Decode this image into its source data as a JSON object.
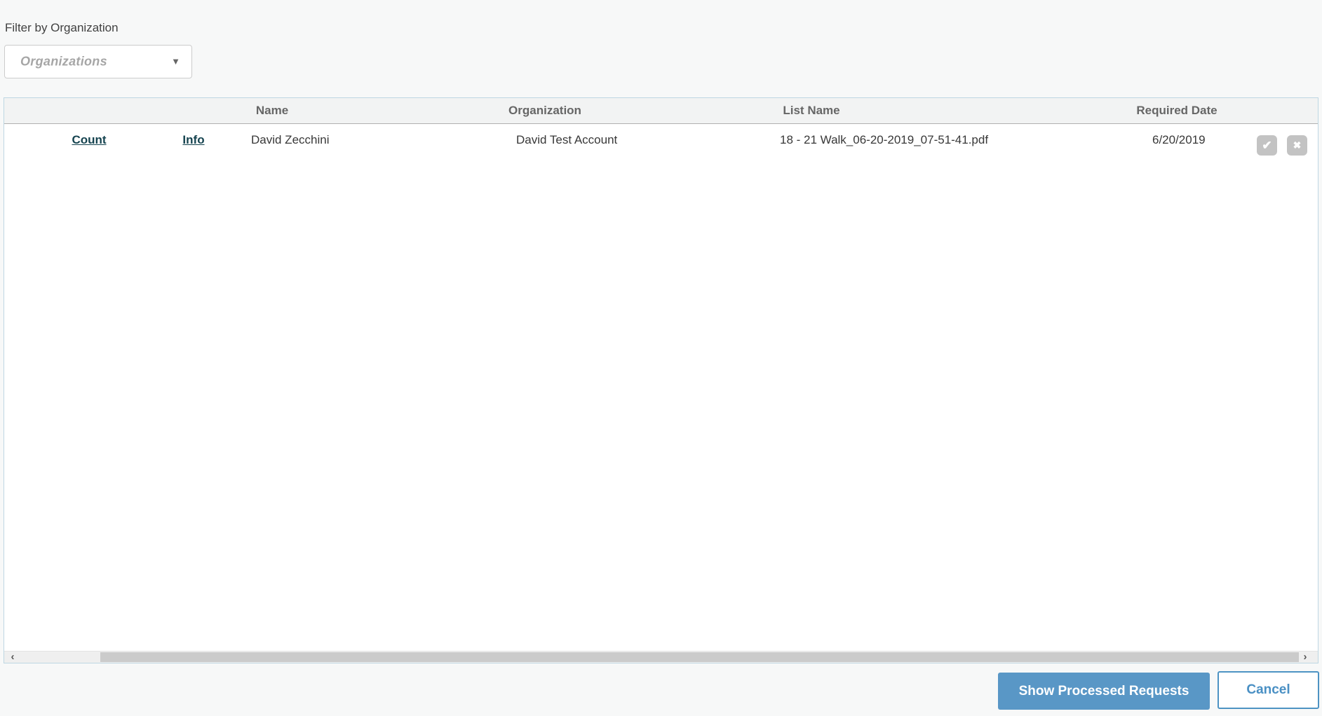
{
  "filter": {
    "label": "Filter by Organization",
    "dropdown_placeholder": "Organizations"
  },
  "icons": {
    "dropdown_arrow": "▼",
    "check": "✔",
    "x": "✖",
    "scroll_left": "‹",
    "scroll_right": "›"
  },
  "table": {
    "headers": {
      "name": "Name",
      "organization": "Organization",
      "list_name": "List Name",
      "required_date": "Required Date"
    },
    "rows": [
      {
        "count_label": "Count",
        "info_label": "Info",
        "name": "David Zecchini",
        "organization": "David Test Account",
        "list_name": "18 - 21 Walk_06-20-2019_07-51-41.pdf",
        "required_date": "6/20/2019"
      }
    ]
  },
  "footer": {
    "show_processed_label": "Show Processed Requests",
    "cancel_label": "Cancel"
  },
  "colors": {
    "accent_blue": "#5997c6",
    "link_teal": "#164450",
    "icon_gray": "#c3c3c3",
    "panel_border": "#bed7e3",
    "header_fill": "#f2f3f3"
  }
}
